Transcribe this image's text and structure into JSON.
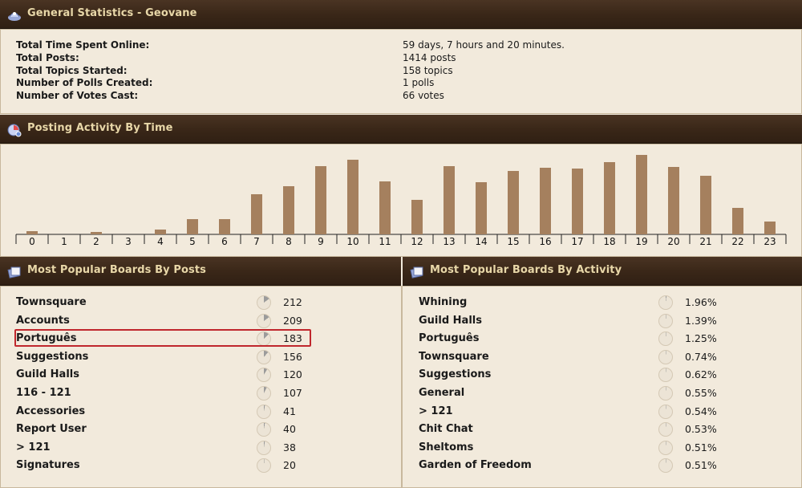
{
  "general": {
    "title": "General Statistics - Geovane",
    "rows": [
      {
        "label": "Total Time Spent Online:",
        "value": "59 days, 7 hours and 20 minutes."
      },
      {
        "label": "Total Posts:",
        "value": "1414 posts"
      },
      {
        "label": "Total Topics Started:",
        "value": "158 topics"
      },
      {
        "label": "Number of Polls Created:",
        "value": "1 polls"
      },
      {
        "label": "Number of Votes Cast:",
        "value": "66 votes"
      }
    ]
  },
  "activity": {
    "title": "Posting Activity By Time"
  },
  "chart_data": {
    "type": "bar",
    "categories": [
      "0",
      "1",
      "2",
      "3",
      "4",
      "5",
      "6",
      "7",
      "8",
      "9",
      "10",
      "11",
      "12",
      "13",
      "14",
      "15",
      "16",
      "17",
      "18",
      "19",
      "20",
      "21",
      "22",
      "23"
    ],
    "values": [
      4,
      0,
      3,
      0,
      6,
      19,
      19,
      50,
      60,
      85,
      93,
      66,
      43,
      85,
      65,
      79,
      83,
      82,
      90,
      99,
      84,
      73,
      33,
      16
    ],
    "ylim": [
      0,
      100
    ],
    "title": "",
    "xlabel": "",
    "ylabel": "",
    "bar_color": "#a5805e",
    "grid": false
  },
  "boards_posts": {
    "title": "Most Popular Boards By Posts",
    "rows": [
      {
        "name": "Townsquare",
        "value": "212",
        "fraction": 0.15
      },
      {
        "name": "Accounts",
        "value": "209",
        "fraction": 0.148
      },
      {
        "name": "Português",
        "value": "183",
        "fraction": 0.129
      },
      {
        "name": "Suggestions",
        "value": "156",
        "fraction": 0.11
      },
      {
        "name": "Guild Halls",
        "value": "120",
        "fraction": 0.085
      },
      {
        "name": "116 - 121",
        "value": "107",
        "fraction": 0.076
      },
      {
        "name": "Accessories",
        "value": "41",
        "fraction": 0.029
      },
      {
        "name": "Report User",
        "value": "40",
        "fraction": 0.028
      },
      {
        "name": "> 121",
        "value": "38",
        "fraction": 0.027
      },
      {
        "name": "Signatures",
        "value": "20",
        "fraction": 0.014
      }
    ]
  },
  "boards_activity": {
    "title": "Most Popular Boards By Activity",
    "rows": [
      {
        "name": "Whining",
        "value": "1.96%",
        "fraction": 0.0196
      },
      {
        "name": "Guild Halls",
        "value": "1.39%",
        "fraction": 0.0139
      },
      {
        "name": "Português",
        "value": "1.25%",
        "fraction": 0.0125
      },
      {
        "name": "Townsquare",
        "value": "0.74%",
        "fraction": 0.0074
      },
      {
        "name": "Suggestions",
        "value": "0.62%",
        "fraction": 0.0062
      },
      {
        "name": "General",
        "value": "0.55%",
        "fraction": 0.0055
      },
      {
        "name": "> 121",
        "value": "0.54%",
        "fraction": 0.0054
      },
      {
        "name": "Chit Chat",
        "value": "0.53%",
        "fraction": 0.0053
      },
      {
        "name": "Sheltoms",
        "value": "0.51%",
        "fraction": 0.0051
      },
      {
        "name": "Garden of Freedom",
        "value": "0.51%",
        "fraction": 0.0051
      }
    ]
  },
  "highlight": {
    "color": "#c0272d",
    "row": "Português"
  }
}
